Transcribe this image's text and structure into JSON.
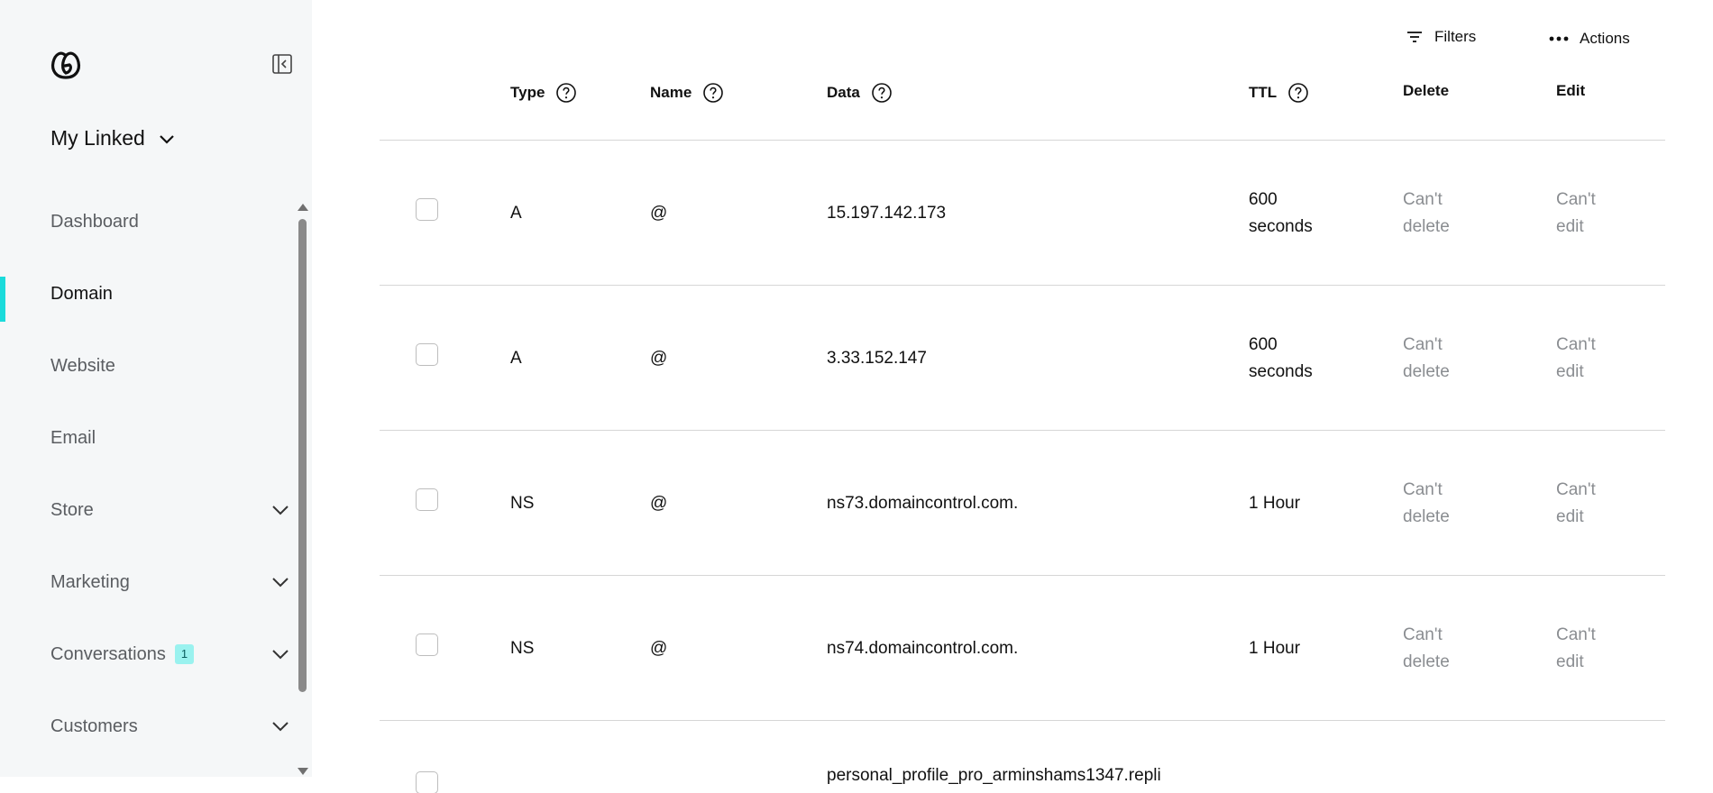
{
  "sidebar": {
    "account_name": "My Linked",
    "items": [
      {
        "label": "Dashboard",
        "active": false,
        "expandable": false
      },
      {
        "label": "Domain",
        "active": true,
        "expandable": false
      },
      {
        "label": "Website",
        "active": false,
        "expandable": false
      },
      {
        "label": "Email",
        "active": false,
        "expandable": false
      },
      {
        "label": "Store",
        "active": false,
        "expandable": true
      },
      {
        "label": "Marketing",
        "active": false,
        "expandable": true
      },
      {
        "label": "Conversations",
        "active": false,
        "expandable": true,
        "badge": "1"
      },
      {
        "label": "Customers",
        "active": false,
        "expandable": true
      }
    ],
    "accent_color": "#1bdbdb"
  },
  "toolbar": {
    "filters_label": "Filters",
    "actions_label": "Actions"
  },
  "table": {
    "columns": {
      "type": "Type",
      "name": "Name",
      "data": "Data",
      "ttl": "TTL",
      "delete": "Delete",
      "edit": "Edit"
    },
    "rows": [
      {
        "type": "A",
        "name": "@",
        "data": "15.197.142.173",
        "ttl": "600 seconds",
        "delete": "Can't delete",
        "edit": "Can't edit"
      },
      {
        "type": "A",
        "name": "@",
        "data": "3.33.152.147",
        "ttl": "600 seconds",
        "delete": "Can't delete",
        "edit": "Can't edit"
      },
      {
        "type": "NS",
        "name": "@",
        "data": "ns73.domaincontrol.com.",
        "ttl": "1 Hour",
        "delete": "Can't delete",
        "edit": "Can't edit"
      },
      {
        "type": "NS",
        "name": "@",
        "data": "ns74.domaincontrol.com.",
        "ttl": "1 Hour",
        "delete": "Can't delete",
        "edit": "Can't edit"
      },
      {
        "type": "",
        "name": "",
        "data": "personal_profile_pro_arminshams1347.repli",
        "ttl": "",
        "delete": "",
        "edit": ""
      }
    ]
  }
}
